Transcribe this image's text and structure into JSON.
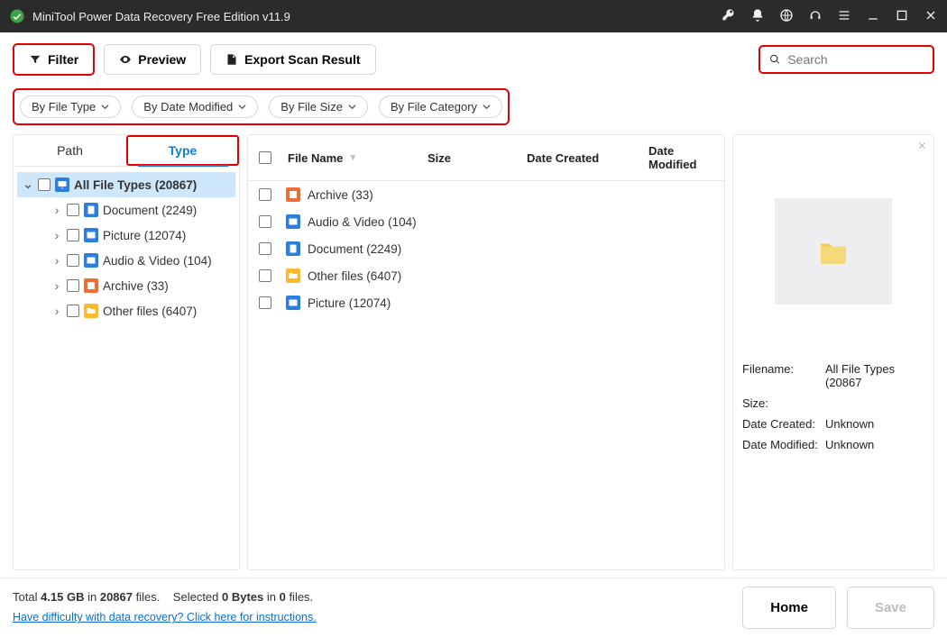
{
  "titlebar": {
    "title": "MiniTool Power Data Recovery Free Edition v11.9"
  },
  "toolbar": {
    "filter": "Filter",
    "preview": "Preview",
    "export": "Export Scan Result",
    "search_placeholder": "Search"
  },
  "filters": {
    "by_type": "By File Type",
    "by_date": "By Date Modified",
    "by_size": "By File Size",
    "by_category": "By File Category"
  },
  "tabs": {
    "path": "Path",
    "type": "Type"
  },
  "tree": {
    "root": "All File Types (20867)",
    "items": [
      {
        "label": "Document (2249)",
        "icon": "doc"
      },
      {
        "label": "Picture (12074)",
        "icon": "pic"
      },
      {
        "label": "Audio & Video (104)",
        "icon": "av"
      },
      {
        "label": "Archive (33)",
        "icon": "arc"
      },
      {
        "label": "Other files (6407)",
        "icon": "oth"
      }
    ]
  },
  "list": {
    "headers": {
      "name": "File Name",
      "size": "Size",
      "created": "Date Created",
      "modified": "Date Modified"
    },
    "rows": [
      {
        "label": "Archive (33)",
        "icon": "arc"
      },
      {
        "label": "Audio & Video (104)",
        "icon": "av"
      },
      {
        "label": "Document (2249)",
        "icon": "doc"
      },
      {
        "label": "Other files (6407)",
        "icon": "oth"
      },
      {
        "label": "Picture (12074)",
        "icon": "pic"
      }
    ]
  },
  "detail": {
    "filename_label": "Filename:",
    "filename": "All File Types (20867",
    "size_label": "Size:",
    "size": "",
    "created_label": "Date Created:",
    "created": "Unknown",
    "modified_label": "Date Modified:",
    "modified": "Unknown"
  },
  "footer": {
    "total_prefix": "Total ",
    "total_size": "4.15 GB",
    "total_mid": " in ",
    "total_count": "20867",
    "total_suffix": " files.",
    "sel_prefix": "Selected ",
    "sel_bytes": "0 Bytes",
    "sel_mid": " in ",
    "sel_count": "0",
    "sel_suffix": " files.",
    "help_link": "Have difficulty with data recovery? Click here for instructions.",
    "home": "Home",
    "save": "Save"
  }
}
